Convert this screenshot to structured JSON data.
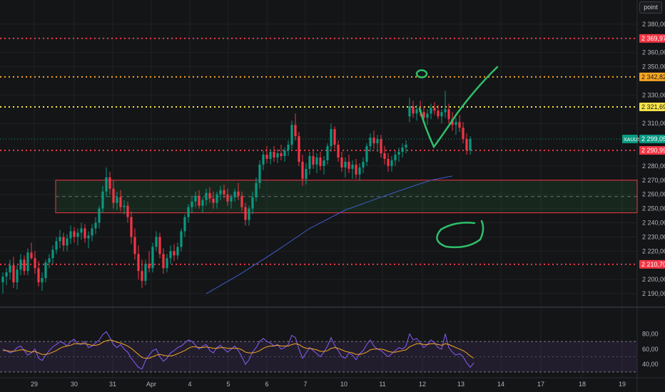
{
  "chart_data": {
    "type": "candlestick",
    "price_pane": {
      "ylim": [
        2184,
        2392
      ],
      "y_ticks": [
        {
          "value": 2380,
          "label": "2 380,00"
        },
        {
          "value": 2370,
          "label": "2 370,00"
        },
        {
          "value": 2360,
          "label": "2 360,00"
        },
        {
          "value": 2350,
          "label": "2 350,00"
        },
        {
          "value": 2330,
          "label": "2 330,00"
        },
        {
          "value": 2310,
          "label": "2 310,00"
        },
        {
          "value": 2280,
          "label": "2 280,00"
        },
        {
          "value": 2270,
          "label": "2 270,00"
        },
        {
          "value": 2260,
          "label": "2 260,00"
        },
        {
          "value": 2250,
          "label": "2 250,00"
        },
        {
          "value": 2240,
          "label": "2 240,00"
        },
        {
          "value": 2230,
          "label": "2 230,00"
        },
        {
          "value": 2220,
          "label": "2 220,00"
        },
        {
          "value": 2200,
          "label": "2 200,00"
        },
        {
          "value": 2190,
          "label": "2 190,00"
        }
      ],
      "level_lines": [
        {
          "value": 2369.97,
          "label": "2 369,97",
          "color": "#f23645"
        },
        {
          "value": 2342.82,
          "label": "2 342,82",
          "color": "#f5a623"
        },
        {
          "value": 2321.69,
          "label": "2 321,69",
          "color": "#f5e44a"
        },
        {
          "value": 2290.99,
          "label": "2 290,99",
          "color": "#f23645"
        },
        {
          "value": 2210.7,
          "label": "2 210,70",
          "color": "#f23645"
        }
      ],
      "current_price": {
        "value": 2299.05,
        "symbol": "XAUUSD",
        "label": "2 299,05",
        "color": "#089981"
      },
      "zone": {
        "low": 2247,
        "high": 2270
      },
      "candles": [
        [
          2198,
          2205,
          2190,
          2202
        ],
        [
          2202,
          2208,
          2196,
          2205
        ],
        [
          2205,
          2214,
          2200,
          2210
        ],
        [
          2210,
          2216,
          2194,
          2198
        ],
        [
          2198,
          2210,
          2193,
          2207
        ],
        [
          2207,
          2218,
          2203,
          2214
        ],
        [
          2214,
          2217,
          2203,
          2206
        ],
        [
          2206,
          2222,
          2203,
          2219
        ],
        [
          2219,
          2226,
          2214,
          2215
        ],
        [
          2215,
          2220,
          2204,
          2208
        ],
        [
          2208,
          2213,
          2195,
          2198
        ],
        [
          2198,
          2205,
          2192,
          2201
        ],
        [
          2201,
          2214,
          2198,
          2212
        ],
        [
          2212,
          2218,
          2208,
          2215
        ],
        [
          2215,
          2224,
          2211,
          2221
        ],
        [
          2221,
          2230,
          2218,
          2227
        ],
        [
          2227,
          2235,
          2222,
          2230
        ],
        [
          2230,
          2233,
          2220,
          2224
        ],
        [
          2224,
          2232,
          2220,
          2229
        ],
        [
          2229,
          2238,
          2225,
          2234
        ],
        [
          2234,
          2237,
          2226,
          2230
        ],
        [
          2230,
          2236,
          2224,
          2233
        ],
        [
          2233,
          2240,
          2228,
          2236
        ],
        [
          2236,
          2239,
          2226,
          2229
        ],
        [
          2229,
          2234,
          2222,
          2231
        ],
        [
          2231,
          2239,
          2227,
          2236
        ],
        [
          2236,
          2244,
          2232,
          2240
        ],
        [
          2240,
          2252,
          2236,
          2250
        ],
        [
          2250,
          2266,
          2247,
          2262
        ],
        [
          2262,
          2279,
          2258,
          2272
        ],
        [
          2272,
          2276,
          2260,
          2264
        ],
        [
          2264,
          2270,
          2250,
          2254
        ],
        [
          2254,
          2262,
          2249,
          2258
        ],
        [
          2258,
          2263,
          2248,
          2251
        ],
        [
          2251,
          2256,
          2246,
          2252
        ],
        [
          2252,
          2255,
          2240,
          2244
        ],
        [
          2244,
          2248,
          2225,
          2230
        ],
        [
          2230,
          2236,
          2214,
          2218
        ],
        [
          2218,
          2224,
          2200,
          2206
        ],
        [
          2206,
          2214,
          2194,
          2199
        ],
        [
          2199,
          2214,
          2196,
          2211
        ],
        [
          2211,
          2220,
          2205,
          2208
        ],
        [
          2208,
          2226,
          2205,
          2223
        ],
        [
          2223,
          2234,
          2220,
          2230
        ],
        [
          2230,
          2233,
          2215,
          2218
        ],
        [
          2218,
          2222,
          2204,
          2208
        ],
        [
          2208,
          2218,
          2205,
          2215
        ],
        [
          2215,
          2224,
          2211,
          2220
        ],
        [
          2220,
          2225,
          2213,
          2217
        ],
        [
          2217,
          2226,
          2214,
          2223
        ],
        [
          2223,
          2236,
          2220,
          2234
        ],
        [
          2234,
          2246,
          2230,
          2244
        ],
        [
          2244,
          2253,
          2240,
          2251
        ],
        [
          2251,
          2258,
          2247,
          2255
        ],
        [
          2255,
          2262,
          2251,
          2259
        ],
        [
          2259,
          2263,
          2250,
          2252
        ],
        [
          2252,
          2258,
          2247,
          2256
        ],
        [
          2256,
          2264,
          2252,
          2261
        ],
        [
          2261,
          2265,
          2254,
          2257
        ],
        [
          2257,
          2262,
          2250,
          2254
        ],
        [
          2254,
          2262,
          2250,
          2260
        ],
        [
          2260,
          2266,
          2256,
          2263
        ],
        [
          2263,
          2267,
          2257,
          2260
        ],
        [
          2260,
          2264,
          2252,
          2255
        ],
        [
          2255,
          2260,
          2250,
          2258
        ],
        [
          2258,
          2264,
          2255,
          2262
        ],
        [
          2262,
          2268,
          2256,
          2259
        ],
        [
          2259,
          2262,
          2248,
          2251
        ],
        [
          2251,
          2254,
          2238,
          2242
        ],
        [
          2242,
          2252,
          2238,
          2250
        ],
        [
          2250,
          2262,
          2246,
          2258
        ],
        [
          2258,
          2272,
          2255,
          2268
        ],
        [
          2268,
          2284,
          2264,
          2281
        ],
        [
          2281,
          2291,
          2277,
          2288
        ],
        [
          2288,
          2294,
          2282,
          2285
        ],
        [
          2285,
          2292,
          2281,
          2290
        ],
        [
          2290,
          2294,
          2283,
          2286
        ],
        [
          2286,
          2292,
          2282,
          2289
        ],
        [
          2289,
          2295,
          2284,
          2287
        ],
        [
          2287,
          2293,
          2283,
          2291
        ],
        [
          2291,
          2298,
          2287,
          2295
        ],
        [
          2295,
          2312,
          2292,
          2309
        ],
        [
          2309,
          2317,
          2298,
          2301
        ],
        [
          2301,
          2304,
          2280,
          2283
        ],
        [
          2283,
          2288,
          2266,
          2271
        ],
        [
          2271,
          2282,
          2267,
          2278
        ],
        [
          2278,
          2290,
          2274,
          2287
        ],
        [
          2287,
          2292,
          2278,
          2281
        ],
        [
          2281,
          2289,
          2275,
          2286
        ],
        [
          2286,
          2290,
          2277,
          2280
        ],
        [
          2280,
          2287,
          2274,
          2284
        ],
        [
          2284,
          2296,
          2281,
          2294
        ],
        [
          2294,
          2310,
          2290,
          2306
        ],
        [
          2306,
          2308,
          2292,
          2295
        ],
        [
          2295,
          2298,
          2283,
          2286
        ],
        [
          2286,
          2290,
          2276,
          2279
        ],
        [
          2279,
          2286,
          2272,
          2283
        ],
        [
          2283,
          2288,
          2275,
          2278
        ],
        [
          2278,
          2284,
          2271,
          2281
        ],
        [
          2281,
          2285,
          2271,
          2274
        ],
        [
          2274,
          2282,
          2270,
          2279
        ],
        [
          2279,
          2286,
          2275,
          2283
        ],
        [
          2283,
          2296,
          2280,
          2294
        ],
        [
          2294,
          2303,
          2290,
          2300
        ],
        [
          2300,
          2305,
          2292,
          2296
        ],
        [
          2296,
          2302,
          2290,
          2299
        ],
        [
          2299,
          2302,
          2286,
          2289
        ],
        [
          2289,
          2294,
          2281,
          2285
        ],
        [
          2285,
          2289,
          2276,
          2280
        ],
        [
          2280,
          2287,
          2276,
          2284
        ],
        [
          2284,
          2291,
          2280,
          2288
        ],
        [
          2288,
          2293,
          2283,
          2290
        ],
        [
          2290,
          2296,
          2286,
          2293
        ],
        [
          2293,
          2298,
          2289,
          2295
        ],
        [
          2315,
          2328,
          2311,
          2322
        ],
        [
          2322,
          2326,
          2314,
          2317
        ],
        [
          2317,
          2323,
          2312,
          2320
        ],
        [
          2320,
          2326,
          2315,
          2318
        ],
        [
          2318,
          2322,
          2311,
          2314
        ],
        [
          2314,
          2320,
          2309,
          2317
        ],
        [
          2317,
          2324,
          2313,
          2321
        ],
        [
          2321,
          2325,
          2316,
          2319
        ],
        [
          2319,
          2323,
          2313,
          2315
        ],
        [
          2315,
          2320,
          2310,
          2318
        ],
        [
          2318,
          2333,
          2314,
          2320
        ],
        [
          2320,
          2324,
          2310,
          2313
        ],
        [
          2313,
          2318,
          2305,
          2309
        ],
        [
          2309,
          2314,
          2302,
          2311
        ],
        [
          2311,
          2316,
          2304,
          2307
        ],
        [
          2307,
          2311,
          2296,
          2299
        ],
        [
          2299,
          2303,
          2288,
          2291
        ],
        [
          2291,
          2301,
          2288,
          2299
        ]
      ],
      "moving_average": {
        "color": "#3f5cc8",
        "points": [
          [
            57,
            2190
          ],
          [
            66,
            2203
          ],
          [
            76,
            2219
          ],
          [
            86,
            2236
          ],
          [
            96,
            2249
          ],
          [
            106,
            2258
          ],
          [
            114,
            2265
          ],
          [
            120,
            2270
          ],
          [
            126,
            2273
          ]
        ]
      },
      "annotations": [
        {
          "type": "check-mark",
          "color": "#2fbf6a"
        },
        {
          "type": "circle",
          "near_value": 2345,
          "color": "#2fbf6a"
        },
        {
          "type": "ellipse",
          "near_value": 2232,
          "color": "#2fbf6a"
        }
      ]
    },
    "rsi_pane": {
      "ylim": [
        28,
        86
      ],
      "y_ticks": [
        {
          "value": 80,
          "label": "80,00"
        },
        {
          "value": 60,
          "label": "60,00"
        },
        {
          "value": 40,
          "label": "40,00"
        }
      ],
      "band": {
        "low": 30,
        "high": 70
      },
      "mid": 50,
      "line_color": "#8b5cf6",
      "signal_color": "#f5a623",
      "values": [
        60,
        58,
        55,
        57,
        62,
        64,
        58,
        52,
        55,
        60,
        48,
        45,
        52,
        58,
        63,
        66,
        70,
        68,
        64,
        70,
        73,
        67,
        66,
        70,
        62,
        64,
        68,
        72,
        79,
        83,
        75,
        66,
        62,
        66,
        60,
        56,
        48,
        42,
        36,
        34,
        45,
        52,
        58,
        60,
        50,
        44,
        48,
        55,
        58,
        62,
        64,
        68,
        72,
        70,
        65,
        60,
        64,
        66,
        58,
        55,
        62,
        65,
        60,
        56,
        60,
        64,
        58,
        50,
        40,
        46,
        56,
        62,
        70,
        74,
        70,
        68,
        64,
        66,
        60,
        62,
        66,
        78,
        75,
        60,
        48,
        55,
        62,
        58,
        54,
        50,
        56,
        64,
        75,
        65,
        58,
        50,
        48,
        55,
        52,
        46,
        54,
        58,
        66,
        72,
        64,
        60,
        58,
        54,
        50,
        54,
        58,
        62,
        60,
        64,
        80,
        72,
        74,
        68,
        62,
        66,
        72,
        68,
        62,
        60,
        80,
        62,
        56,
        52,
        54,
        50,
        42,
        36,
        42
      ],
      "signal": [
        58,
        58,
        57,
        57,
        58,
        59,
        59,
        57,
        56,
        57,
        55,
        53,
        53,
        54,
        56,
        58,
        61,
        63,
        64,
        65,
        67,
        67,
        67,
        67,
        66,
        65,
        65,
        66,
        69,
        71,
        72,
        71,
        69,
        68,
        66,
        64,
        61,
        57,
        53,
        49,
        48,
        48,
        50,
        52,
        53,
        52,
        51,
        51,
        52,
        54,
        56,
        58,
        61,
        63,
        63,
        62,
        62,
        63,
        62,
        61,
        61,
        62,
        62,
        61,
        61,
        61,
        61,
        59,
        56,
        55,
        55,
        56,
        58,
        61,
        63,
        64,
        64,
        65,
        64,
        64,
        64,
        66,
        67,
        66,
        63,
        61,
        61,
        60,
        59,
        57,
        57,
        58,
        61,
        62,
        61,
        59,
        57,
        56,
        55,
        53,
        53,
        54,
        56,
        59,
        60,
        60,
        60,
        59,
        57,
        56,
        56,
        57,
        58,
        59,
        63,
        65,
        67,
        67,
        66,
        66,
        67,
        67,
        66,
        65,
        67,
        66,
        64,
        62,
        60,
        58,
        55,
        51,
        48
      ]
    },
    "x_ticks": [
      "29",
      "30",
      "31",
      "Apr",
      "4",
      "5",
      "6",
      "7",
      "10",
      "11",
      "12",
      "13",
      "14",
      "17",
      "18",
      "19"
    ],
    "corner_label": "point"
  },
  "colors": {
    "up": "#089981",
    "down": "#f23645",
    "background": "#141517",
    "grid": "#1f2126",
    "axis_text": "#b2b5be"
  }
}
